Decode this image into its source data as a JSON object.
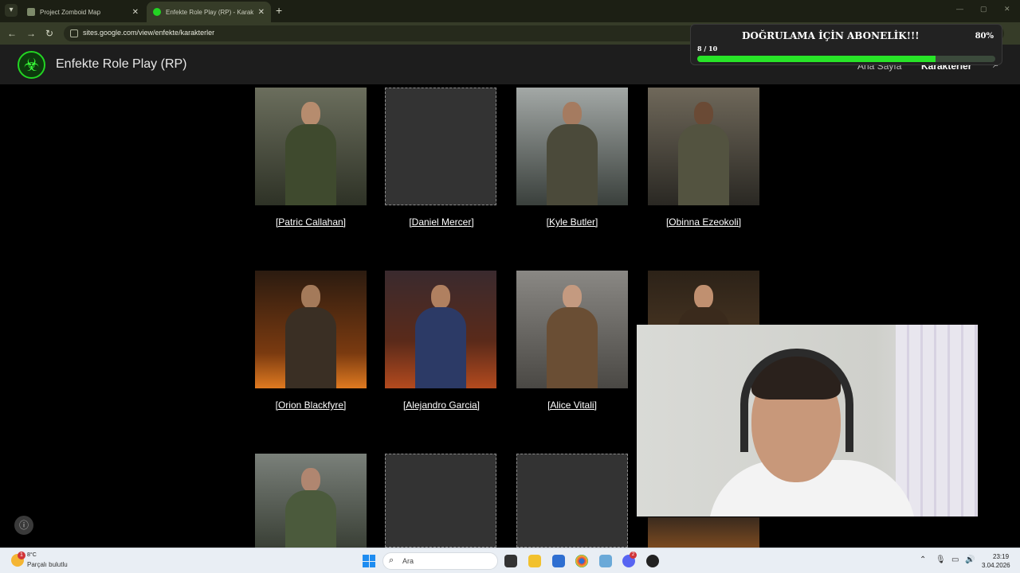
{
  "browser": {
    "tabs": [
      {
        "label": "Project Zomboid Map",
        "active": false
      },
      {
        "label": "Enfekte Role Play (RP) - Karakterler",
        "active": true
      }
    ],
    "new_tab_symbol": "+",
    "url": "sites.google.com/view/enfekte/karakterler",
    "nav_icons": [
      "back-icon",
      "forward-icon",
      "reload-icon"
    ]
  },
  "site": {
    "logo_icon": "biohazard-icon",
    "title": "Enfekte Role Play (RP)",
    "nav": [
      {
        "label": "Ana Sayfa",
        "current": false
      },
      {
        "label": "Karakterler",
        "current": true
      }
    ]
  },
  "promo": {
    "title": "DOĞRULAMA İÇİN ABONELİK!!!",
    "count": "8 / 10",
    "percent_label": "80%",
    "progress_fraction": 0.8,
    "fill_color": "#28e428"
  },
  "characters": [
    {
      "name": "[Patric Callahan]",
      "has_image": true,
      "tone": "#4a4f3a"
    },
    {
      "name": "[Daniel Mercer]",
      "has_image": false,
      "tone": "#333333"
    },
    {
      "name": "[Kyle Butler]",
      "has_image": true,
      "tone": "#5b6260"
    },
    {
      "name": "[Obinna Ezeokoli]",
      "has_image": true,
      "tone": "#4e4a3e"
    },
    {
      "name": "[Orion Blackfyre]",
      "has_image": true,
      "tone": "#6b3a18"
    },
    {
      "name": "[Alejandro Garcia]",
      "has_image": true,
      "tone": "#2f3c5c"
    },
    {
      "name": "[Alice Vitali]",
      "has_image": true,
      "tone": "#6a6762"
    },
    {
      "name": "",
      "has_image": true,
      "tone": "#5a4128"
    },
    {
      "name": "",
      "has_image": true,
      "tone": "#4b5246"
    },
    {
      "name": "",
      "has_image": false,
      "tone": "#333333"
    },
    {
      "name": "",
      "has_image": false,
      "tone": "#333333"
    },
    {
      "name": "",
      "has_image": true,
      "tone": "#4a3a2a"
    }
  ],
  "taskbar": {
    "weather_temp": "8°C",
    "weather_desc": "Parçalı bulutlu",
    "weather_badge": "1",
    "search_placeholder": "Ara",
    "discord_badge": "2",
    "time": "23:19",
    "date": "3.04.2026"
  }
}
